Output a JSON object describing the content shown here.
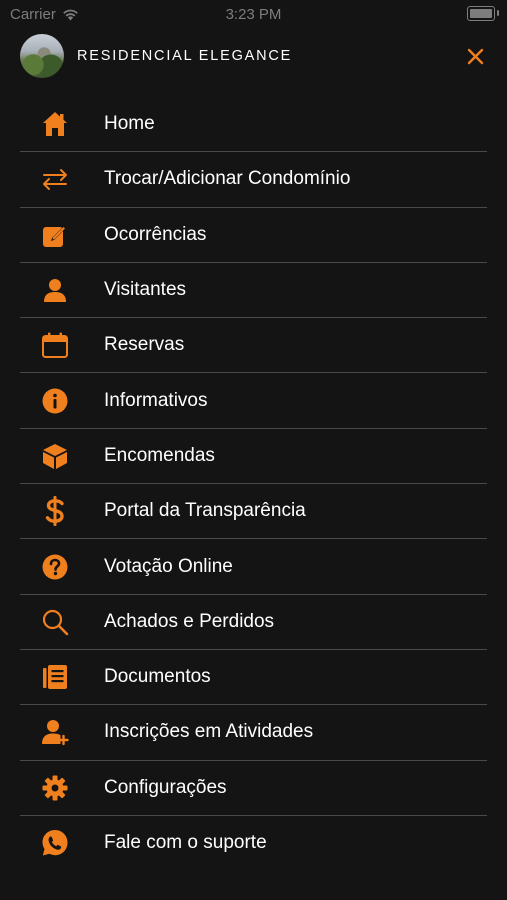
{
  "status_bar": {
    "carrier": "Carrier",
    "time": "3:23 PM"
  },
  "header": {
    "condo_name": "RESIDENCIAL ELEGANCE"
  },
  "colors": {
    "accent": "#f07f1e",
    "background": "#141414",
    "divider": "#4a4a4a",
    "text": "#ffffff"
  },
  "menu": {
    "items": [
      {
        "label": "Home",
        "icon": "home-icon"
      },
      {
        "label": "Trocar/Adicionar Condomínio",
        "icon": "swap-arrows-icon"
      },
      {
        "label": "Ocorrências",
        "icon": "edit-note-icon"
      },
      {
        "label": "Visitantes",
        "icon": "person-icon"
      },
      {
        "label": "Reservas",
        "icon": "calendar-icon"
      },
      {
        "label": "Informativos",
        "icon": "info-icon"
      },
      {
        "label": "Encomendas",
        "icon": "package-icon"
      },
      {
        "label": "Portal da Transparência",
        "icon": "dollar-icon"
      },
      {
        "label": "Votação Online",
        "icon": "question-icon"
      },
      {
        "label": "Achados e Perdidos",
        "icon": "search-icon"
      },
      {
        "label": "Documentos",
        "icon": "document-icon"
      },
      {
        "label": "Inscrições em Atividades",
        "icon": "person-add-icon"
      },
      {
        "label": "Configurações",
        "icon": "gear-icon"
      },
      {
        "label": "Fale com o suporte",
        "icon": "whatsapp-icon"
      }
    ]
  }
}
